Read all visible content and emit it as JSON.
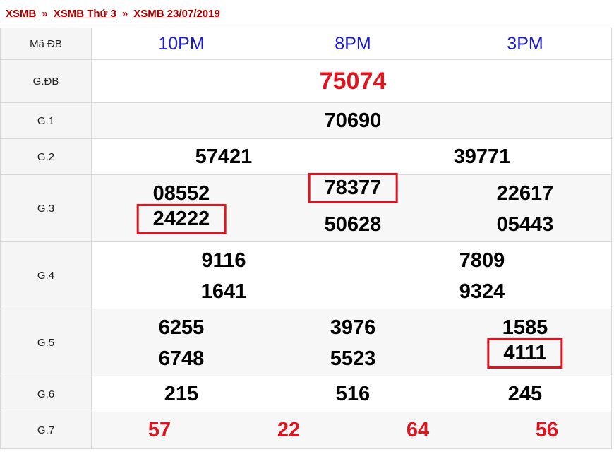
{
  "breadcrumb": {
    "items": [
      "XSMB",
      "XSMB Thứ 3",
      "XSMB 23/07/2019"
    ],
    "separator": "»"
  },
  "header": {
    "label": "Mã ĐB",
    "codes": [
      "10PM",
      "8PM",
      "3PM"
    ]
  },
  "prizes": {
    "gdb": {
      "label": "G.ĐB",
      "numbers": [
        "75074"
      ]
    },
    "g1": {
      "label": "G.1",
      "numbers": [
        "70690"
      ]
    },
    "g2": {
      "label": "G.2",
      "numbers": [
        "57421",
        "39771"
      ]
    },
    "g3": {
      "label": "G.3",
      "numbers": [
        "08552",
        "78377",
        "22617",
        "24222",
        "50628",
        "05443"
      ]
    },
    "g4": {
      "label": "G.4",
      "numbers": [
        "9116",
        "7809",
        "1641",
        "9324"
      ]
    },
    "g5": {
      "label": "G.5",
      "numbers": [
        "6255",
        "3976",
        "1585",
        "6748",
        "5523",
        "4111"
      ]
    },
    "g6": {
      "label": "G.6",
      "numbers": [
        "215",
        "516",
        "245"
      ]
    },
    "g7": {
      "label": "G.7",
      "numbers": [
        "57",
        "22",
        "64",
        "56"
      ]
    }
  },
  "highlighted": [
    "78377",
    "24222",
    "4111"
  ],
  "colors": {
    "breadcrumb_link": "#a40000",
    "special_prize": "#e0141e",
    "header_code": "#1a1ad0",
    "highlight_box": "#e0141e"
  }
}
